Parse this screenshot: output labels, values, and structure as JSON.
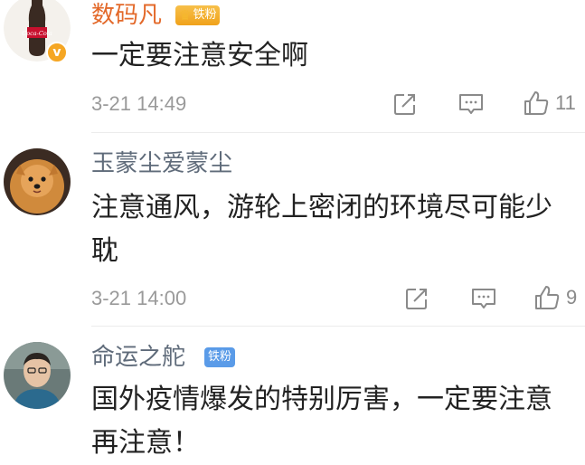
{
  "comments": [
    {
      "username": "数码凡",
      "username_color": "#e3692a",
      "badge": "铁粉",
      "badge_style": "gold-crown",
      "verified": true,
      "text": "一定要注意安全啊",
      "time": "3-21 14:49",
      "likes": "11",
      "avatar_text": "Coca-Cola"
    },
    {
      "username": "玉蒙尘爱蒙尘",
      "username_color": "#5f6b7a",
      "text": "注意通风，游轮上密闭的环境尽可能少耽",
      "time": "3-21 14:00",
      "likes": "9"
    },
    {
      "username": "命运之舵",
      "username_color": "#5f6b7a",
      "badge": "铁粉",
      "badge_style": "blue",
      "text": "国外疫情爆发的特别厉害，一定要注意再注意！"
    }
  ],
  "icons": {
    "share": "share-icon",
    "comment": "comment-icon",
    "like": "thumbs-up-icon"
  },
  "colors": {
    "verified": "#f5a623",
    "text": "#222222",
    "meta": "#9a9a9a"
  }
}
